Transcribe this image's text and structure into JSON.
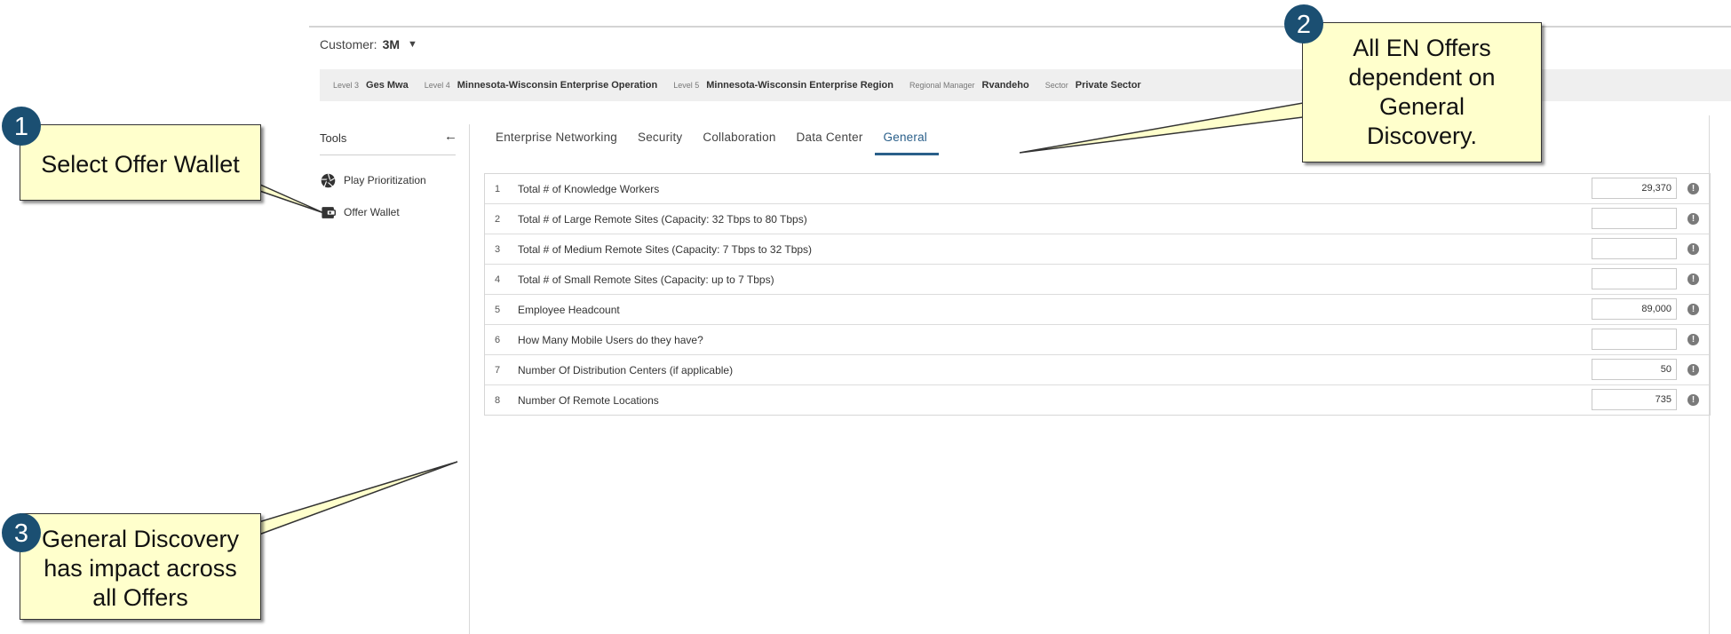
{
  "customer": {
    "label": "Customer:",
    "value": "3M"
  },
  "info_bar": [
    {
      "label": "Level 3",
      "value": "Ges Mwa"
    },
    {
      "label": "Level 4",
      "value": "Minnesota-Wisconsin Enterprise Operation"
    },
    {
      "label": "Level 5",
      "value": "Minnesota-Wisconsin Enterprise Region"
    },
    {
      "label": "Regional Manager",
      "value": "Rvandeho"
    },
    {
      "label": "Sector",
      "value": "Private Sector"
    }
  ],
  "tools": {
    "title": "Tools",
    "items": [
      {
        "label": "Play Prioritization",
        "icon": "aperture-icon"
      },
      {
        "label": "Offer Wallet",
        "icon": "wallet-icon"
      }
    ]
  },
  "tabs": [
    {
      "label": "Enterprise Networking",
      "active": false
    },
    {
      "label": "Security",
      "active": false
    },
    {
      "label": "Collaboration",
      "active": false
    },
    {
      "label": "Data Center",
      "active": false
    },
    {
      "label": "General",
      "active": true
    }
  ],
  "questions": [
    {
      "num": "1",
      "text": "Total # of Knowledge Workers",
      "value": "29,370"
    },
    {
      "num": "2",
      "text": "Total # of Large Remote Sites (Capacity: 32 Tbps to 80 Tbps)",
      "value": ""
    },
    {
      "num": "3",
      "text": "Total # of Medium Remote Sites (Capacity: 7 Tbps to 32 Tbps)",
      "value": ""
    },
    {
      "num": "4",
      "text": "Total # of Small Remote Sites (Capacity: up to 7 Tbps)",
      "value": ""
    },
    {
      "num": "5",
      "text": "Employee Headcount",
      "value": "89,000"
    },
    {
      "num": "6",
      "text": "How Many Mobile Users do they have?",
      "value": ""
    },
    {
      "num": "7",
      "text": "Number Of Distribution Centers (if applicable)",
      "value": "50"
    },
    {
      "num": "8",
      "text": "Number Of Remote Locations",
      "value": "735"
    }
  ],
  "callouts": [
    {
      "badge": "1",
      "lines": [
        "Select Offer Wallet"
      ]
    },
    {
      "badge": "2",
      "lines": [
        "All EN Offers",
        "dependent on",
        "General",
        "Discovery."
      ]
    },
    {
      "badge": "3",
      "lines": [
        "General Discovery",
        "has impact across",
        "all Offers"
      ]
    }
  ],
  "colors": {
    "accent": "#2a5f8a",
    "badge": "#1b4f72",
    "callout_fill": "#ffffcc",
    "info_bar_bg": "#efefef"
  }
}
